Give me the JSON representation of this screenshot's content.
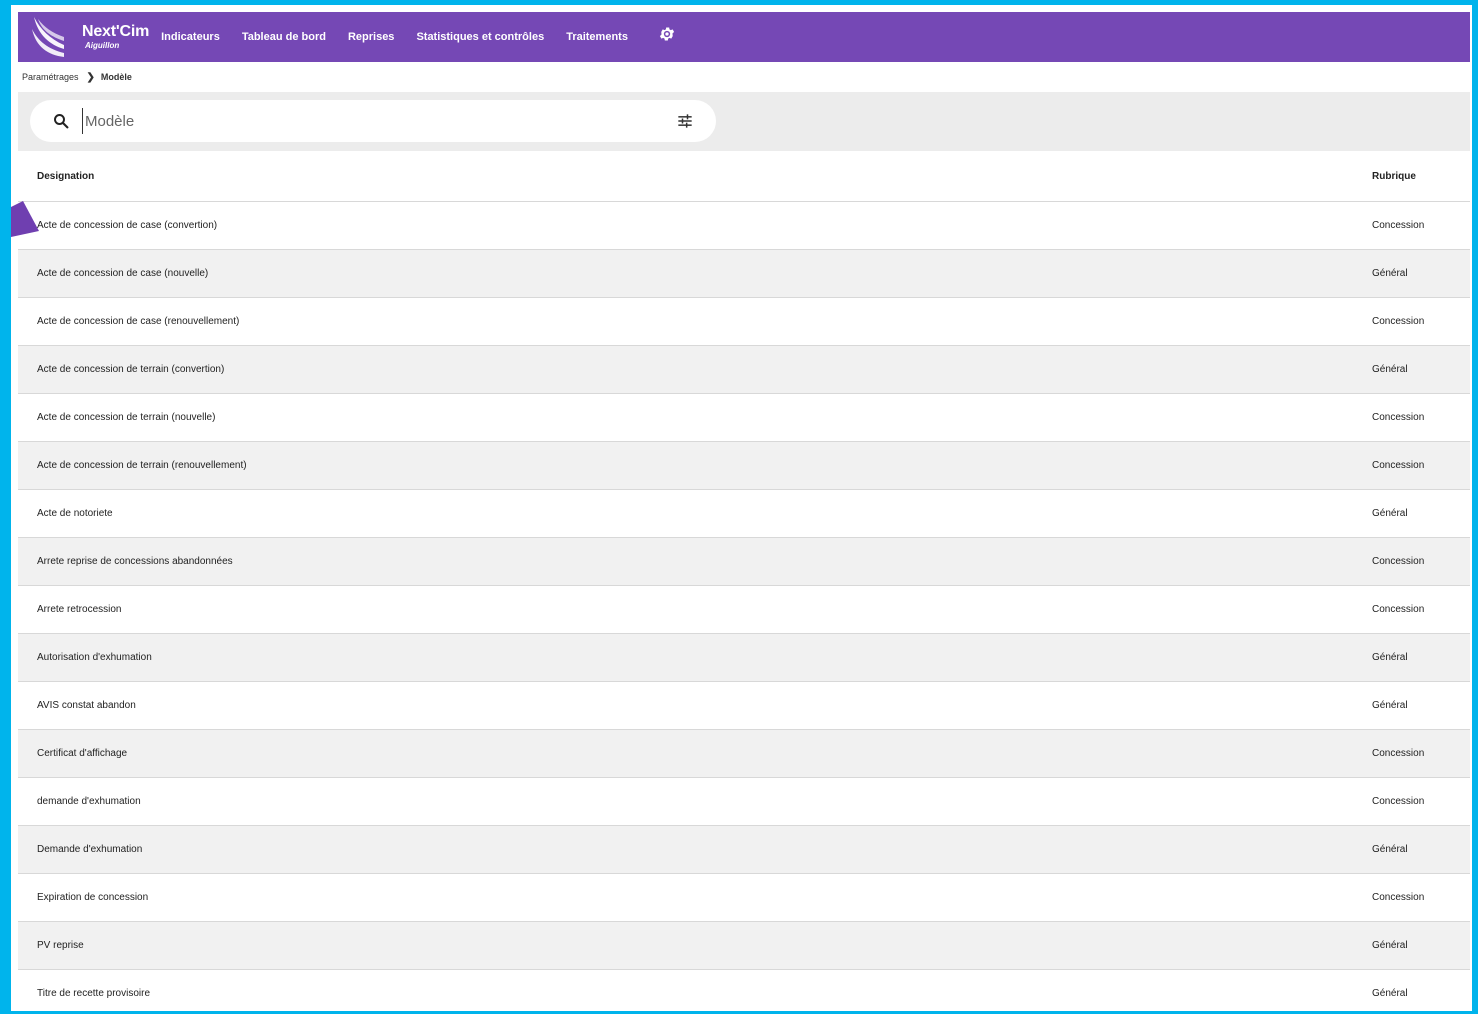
{
  "app": {
    "name": "Next'Cim",
    "subtitle": "Aiguillon"
  },
  "nav": {
    "items": [
      "Indicateurs",
      "Tableau de bord",
      "Reprises",
      "Statistiques et contrôles",
      "Traitements"
    ],
    "settings_icon": "gear-icon"
  },
  "breadcrumb": {
    "parent": "Paramétrages",
    "separator": ">",
    "current": "Modèle"
  },
  "search": {
    "placeholder": "Modèle",
    "value": ""
  },
  "table": {
    "headers": {
      "designation": "Designation",
      "rubrique": "Rubrique"
    },
    "rows": [
      {
        "designation": "Acte de concession de case (convertion)",
        "rubrique": "Concession"
      },
      {
        "designation": "Acte de concession de case (nouvelle)",
        "rubrique": "Général"
      },
      {
        "designation": "Acte de concession de case (renouvellement)",
        "rubrique": "Concession"
      },
      {
        "designation": "Acte de concession de terrain (convertion)",
        "rubrique": "Général"
      },
      {
        "designation": "Acte de concession de terrain (nouvelle)",
        "rubrique": "Concession"
      },
      {
        "designation": "Acte de concession de terrain (renouvellement)",
        "rubrique": "Concession"
      },
      {
        "designation": "Acte de notoriete",
        "rubrique": "Général"
      },
      {
        "designation": "Arrete reprise de concessions abandonnées",
        "rubrique": "Concession"
      },
      {
        "designation": "Arrete retrocession",
        "rubrique": "Concession"
      },
      {
        "designation": "Autorisation d'exhumation",
        "rubrique": "Général"
      },
      {
        "designation": "AVIS constat abandon",
        "rubrique": "Général"
      },
      {
        "designation": "Certificat d'affichage",
        "rubrique": "Concession"
      },
      {
        "designation": "demande d'exhumation",
        "rubrique": "Concession"
      },
      {
        "designation": "Demande d'exhumation",
        "rubrique": "Général"
      },
      {
        "designation": "Expiration de concession",
        "rubrique": "Concession"
      },
      {
        "designation": "PV reprise",
        "rubrique": "Général"
      },
      {
        "designation": "Titre de recette provisoire",
        "rubrique": "Général"
      }
    ]
  },
  "colors": {
    "topbar": "#7548b5",
    "frame": "#00b4ec",
    "arrow": "#6f3fb0"
  }
}
